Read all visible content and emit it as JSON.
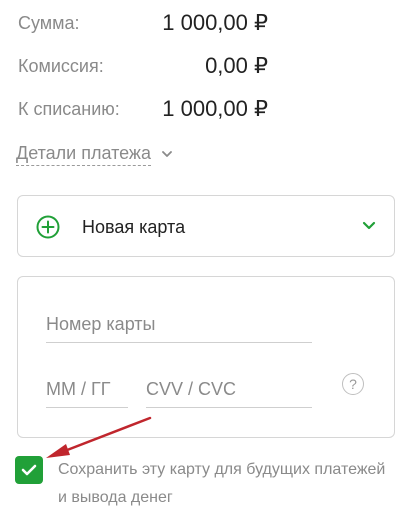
{
  "summary": {
    "amount_label": "Сумма:",
    "amount_value": "1 000,00 ₽",
    "commission_label": "Комиссия:",
    "commission_value": "0,00 ₽",
    "total_label": "К списанию:",
    "total_value": "1 000,00 ₽"
  },
  "details_link": {
    "label": "Детали платежа",
    "icon": "chevron-down-icon"
  },
  "card_select": {
    "selected": "Новая карта",
    "icon": "plus-circle-icon",
    "accent_color": "#21a038"
  },
  "card_form": {
    "card_number_placeholder": "Номер карты",
    "expiry_placeholder": "ММ / ГГ",
    "cvv_placeholder": "CVV / CVC",
    "help_label": "?"
  },
  "save_card": {
    "checked": true,
    "label": "Сохранить эту карту для будущих платежей и вывода денег",
    "checkbox_color": "#21a038"
  },
  "annotation": {
    "icon": "red-arrow-annotation",
    "color": "#c0262d"
  }
}
